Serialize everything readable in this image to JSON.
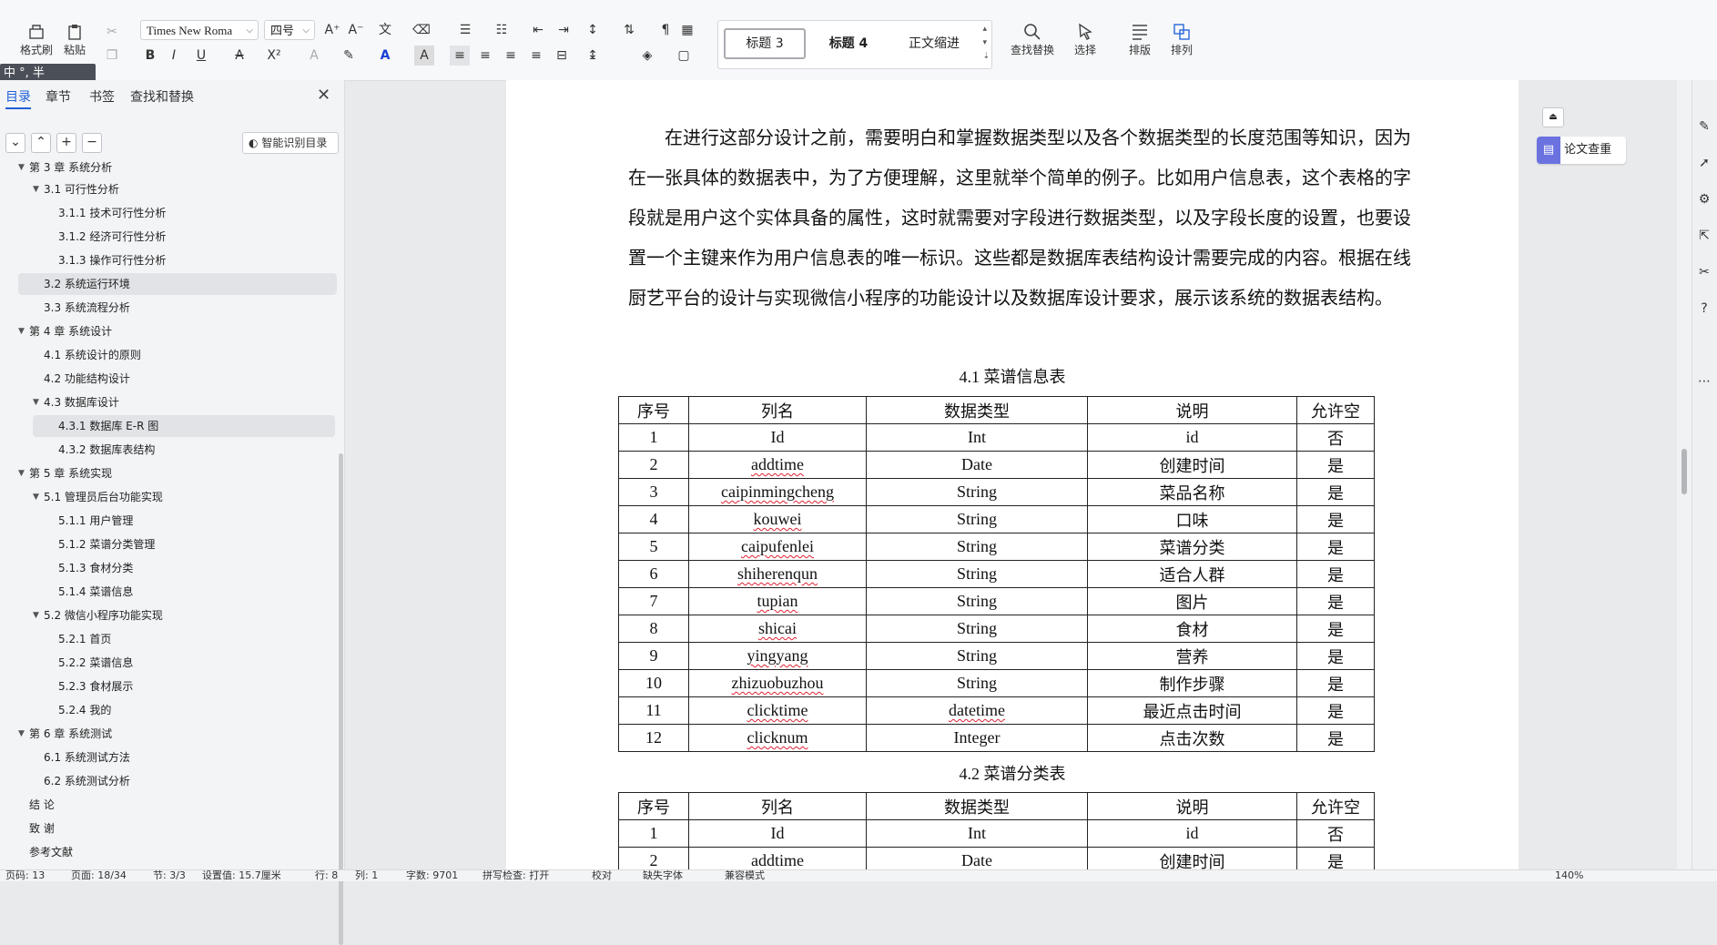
{
  "ribbon": {
    "format_painter": "格式刷",
    "paste": "粘贴",
    "font_name": "Times New Roma",
    "font_size": "四号",
    "styles": [
      "标题 3",
      "标题 4",
      "正文缩进"
    ],
    "find_replace": "查找替换",
    "select": "选择",
    "layout": "排版",
    "arrange": "排列"
  },
  "ime": {
    "text": "中 °, 半"
  },
  "nav": {
    "tabs": [
      "目录",
      "章节",
      "书签",
      "查找和替换"
    ],
    "auto_toc": "智能识别目录",
    "toc": [
      "第 3 章 系统分析",
      "3.1 可行性分析",
      "3.1.1 技术可行性分析",
      "3.1.2 经济可行性分析",
      "3.1.3 操作可行性分析",
      "3.2 系统运行环境",
      "3.3 系统流程分析",
      "第 4 章  系统设计",
      "4.1  系统设计的原则",
      "4.2  功能结构设计",
      "4.3  数据库设计",
      "4.3.1  数据库 E-R 图",
      "4.3.2  数据库表结构",
      "第 5 章  系统实现",
      "5.1 管理员后台功能实现",
      "5.1.1  用户管理",
      "5.1.2  菜谱分类管理",
      "5.1.3  食材分类",
      "5.1.4  菜谱信息",
      "5.2  微信小程序功能实现",
      "5.2.1  首页",
      "5.2.2  菜谱信息",
      "5.2.3  食材展示",
      "5.2.4  我的",
      "第 6 章  系统测试",
      "6.1 系统测试方法",
      "6.2  系统测试分析",
      "结   论",
      "致   谢",
      "参考文献"
    ]
  },
  "document": {
    "paragraph": "在进行这部分设计之前，需要明白和掌握数据类型以及各个数据类型的长度范围等知识，因为在一张具体的数据表中，为了方便理解，这里就举个简单的例子。比如用户信息表，这个表格的字段就是用户这个实体具备的属性，这时就需要对字段进行数据类型，以及字段长度的设置，也要设置一个主键来作为用户信息表的唯一标识。这些都是数据库表结构设计需要完成的内容。根据在线厨艺平台的设计与实现微信小程序的功能设计以及数据库设计要求，展示该系统的数据表结构。",
    "caption1": "4.1 菜谱信息表",
    "caption2": "4.2 菜谱分类表",
    "headers": [
      "序号",
      "列名",
      "数据类型",
      "说明",
      "允许空"
    ],
    "table1": [
      [
        "1",
        "Id",
        "Int",
        "id",
        "否"
      ],
      [
        "2",
        "addtime",
        "Date",
        "创建时间",
        "是"
      ],
      [
        "3",
        "caipinmingcheng",
        "String",
        "菜品名称",
        "是"
      ],
      [
        "4",
        "kouwei",
        "String",
        "口味",
        "是"
      ],
      [
        "5",
        "caipufenlei",
        "String",
        "菜谱分类",
        "是"
      ],
      [
        "6",
        "shiherenqun",
        "String",
        "适合人群",
        "是"
      ],
      [
        "7",
        "tupian",
        "String",
        "图片",
        "是"
      ],
      [
        "8",
        "shicai",
        "String",
        "食材",
        "是"
      ],
      [
        "9",
        "yingyang",
        "String",
        "营养",
        "是"
      ],
      [
        "10",
        "zhizuobuzhou",
        "String",
        "制作步骤",
        "是"
      ],
      [
        "11",
        "clicktime",
        "datetime",
        "最近点击时间",
        "是"
      ],
      [
        "12",
        "clicknum",
        "Integer",
        "点击次数",
        "是"
      ]
    ],
    "table2": [
      [
        "1",
        "Id",
        "Int",
        "id",
        "否"
      ],
      [
        "2",
        "addtime",
        "Date",
        "创建时间",
        "是"
      ]
    ]
  },
  "right_panel": {
    "plagiarism_check": "论文查重"
  },
  "status": {
    "page_no": "页码: 13",
    "pages": "页面: 18/34",
    "section": "节: 3/3",
    "setting": "设置值: 15.7厘米",
    "row": "行: 8",
    "col": "列: 1",
    "words": "字数: 9701",
    "spell": "拼写检查: 打开",
    "proof": "校对",
    "missing_font": "缺失字体",
    "compat": "兼容模式",
    "zoom": "140%"
  }
}
